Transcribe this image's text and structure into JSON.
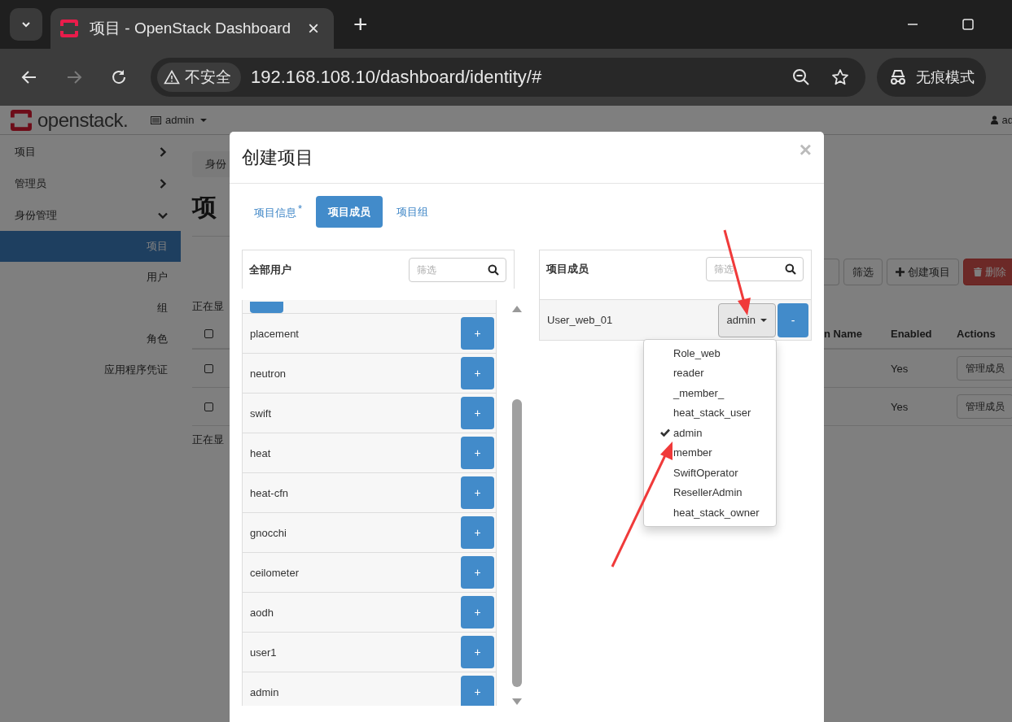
{
  "browser": {
    "tab_title": "项目 - OpenStack Dashboard",
    "tab_close": "×",
    "new_tab": "+",
    "security_label": "不安全",
    "url": "192.168.108.10/dashboard/identity/#",
    "incognito_label": "无痕模式"
  },
  "header": {
    "logo_text": "openstack.",
    "project_menu": "admin",
    "user_menu": "ad"
  },
  "sidebar": {
    "items": [
      {
        "label": "项目",
        "expanded": false
      },
      {
        "label": "管理员",
        "expanded": false
      },
      {
        "label": "身份管理",
        "expanded": true,
        "children": [
          {
            "label": "项目",
            "selected": true
          },
          {
            "label": "用户",
            "selected": false
          },
          {
            "label": "组",
            "selected": false
          },
          {
            "label": "角色",
            "selected": false
          },
          {
            "label": "应用程序凭证",
            "selected": false
          }
        ]
      }
    ]
  },
  "page": {
    "breadcrumb": "身份",
    "heading": "项",
    "summary_top": "正在显",
    "summary_bottom": "正在显",
    "toolbar": {
      "filter_button": "筛选",
      "create_button": "创建项目",
      "delete_button": "删除"
    },
    "table": {
      "select_all_checked": false,
      "columns": [
        "n Name",
        "Enabled",
        "Actions"
      ],
      "rows": [
        {
          "checked": false,
          "enabled": "Yes",
          "action": "管理成员"
        },
        {
          "checked": false,
          "enabled": "Yes",
          "action": "管理成员"
        }
      ]
    }
  },
  "modal": {
    "title": "创建项目",
    "close": "×",
    "tabs": [
      {
        "label": "项目信息",
        "required_mark": "*",
        "selected": false
      },
      {
        "label": "项目成员",
        "selected": true
      },
      {
        "label": "项目组",
        "selected": false
      }
    ],
    "all_users": {
      "title": "全部用户",
      "filter_placeholder": "筛选",
      "users": [
        {
          "name": "placement",
          "button": "+"
        },
        {
          "name": "neutron",
          "button": "+"
        },
        {
          "name": "swift",
          "button": "+"
        },
        {
          "name": "heat",
          "button": "+"
        },
        {
          "name": "heat-cfn",
          "button": "+"
        },
        {
          "name": "gnocchi",
          "button": "+"
        },
        {
          "name": "ceilometer",
          "button": "+"
        },
        {
          "name": "aodh",
          "button": "+"
        },
        {
          "name": "user1",
          "button": "+"
        },
        {
          "name": "admin",
          "button": "+"
        }
      ]
    },
    "members": {
      "title": "项目成员",
      "filter_placeholder": "筛选",
      "rows": [
        {
          "name": "User_web_01",
          "role": "admin",
          "button": "-"
        }
      ]
    },
    "role_menu": {
      "options": [
        {
          "label": "Role_web",
          "selected": false
        },
        {
          "label": "reader",
          "selected": false
        },
        {
          "label": "_member_",
          "selected": false
        },
        {
          "label": "heat_stack_user",
          "selected": false
        },
        {
          "label": "admin",
          "selected": true
        },
        {
          "label": "member",
          "selected": false
        },
        {
          "label": "SwiftOperator",
          "selected": false
        },
        {
          "label": "ResellerAdmin",
          "selected": false
        },
        {
          "label": "heat_stack_owner",
          "selected": false
        }
      ]
    }
  }
}
